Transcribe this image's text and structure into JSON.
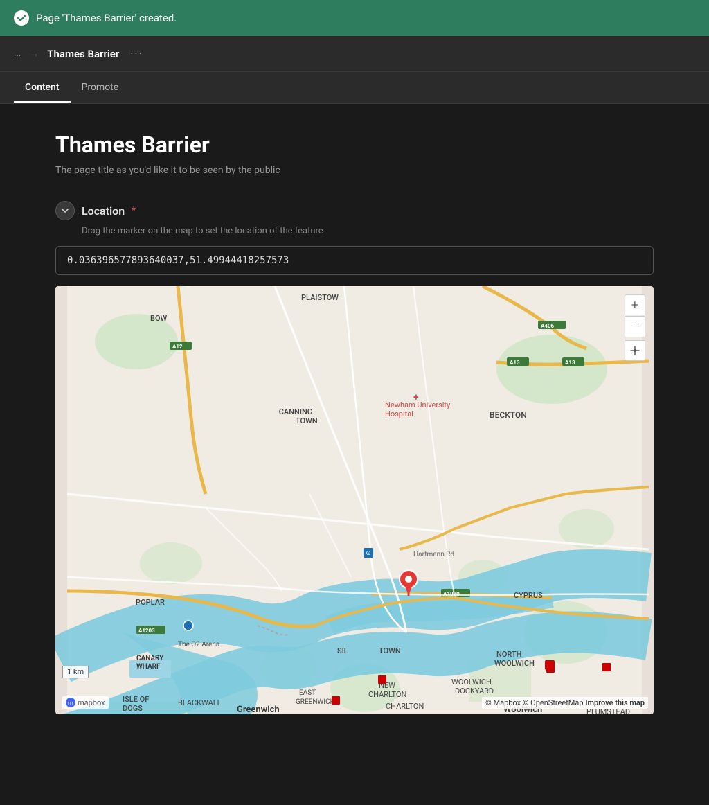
{
  "success_banner": {
    "message": "Page 'Thames Barrier' created.",
    "icon": "checkmark"
  },
  "top_nav": {
    "breadcrumb_dots": "...",
    "breadcrumb_arrow": "→",
    "page_title": "Thames Barrier",
    "more_options": "···"
  },
  "tabs": [
    {
      "label": "Content",
      "active": true
    },
    {
      "label": "Promote",
      "active": false
    }
  ],
  "content": {
    "heading": "Thames Barrier",
    "subheading": "The page title as you'd like it to be seen by the public",
    "location_section": {
      "label": "Location",
      "required": true,
      "description": "Drag the marker on the map to set the location of the feature",
      "coordinates": "0.036396577893640037,51.49944418257573"
    }
  },
  "map": {
    "zoom_in_label": "+",
    "zoom_out_label": "−",
    "compass_label": "↑",
    "scale_label": "1 km",
    "attribution": "© Mapbox © OpenStreetMap",
    "improve_label": "Improve this map",
    "mapbox_label": "mapbox"
  }
}
